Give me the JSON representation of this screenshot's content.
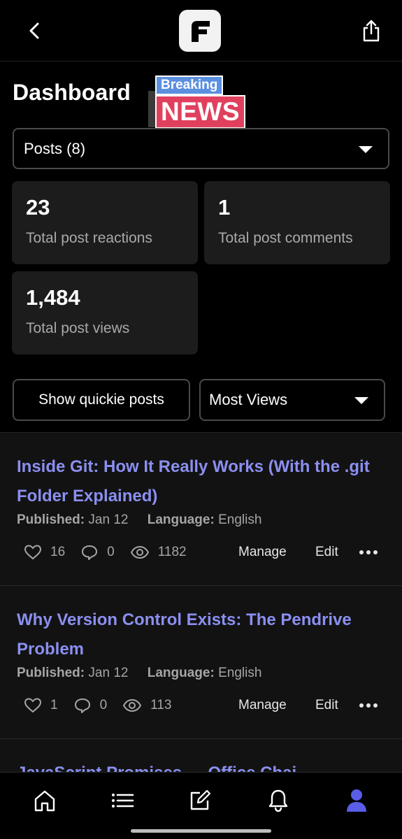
{
  "header": {
    "title": "Dashboard",
    "badge_top": "Breaking",
    "badge_bottom": "NEWS"
  },
  "posts_select": {
    "value": "Posts (8)"
  },
  "stats": [
    {
      "value": "23",
      "label": "Total post reactions"
    },
    {
      "value": "1",
      "label": "Total post comments"
    },
    {
      "value": "1,484",
      "label": "Total post views"
    }
  ],
  "filters": {
    "quickie_label": "Show quickie posts",
    "sort_value": "Most Views"
  },
  "posts": [
    {
      "title": "Inside Git: How It Really Works (With the .git Folder Explained)",
      "published_label": "Published:",
      "published": "Jan 12",
      "language_label": "Language:",
      "language": "English",
      "likes": "16",
      "comments": "0",
      "views": "1182",
      "manage": "Manage",
      "edit": "Edit"
    },
    {
      "title": "Why Version Control Exists: The Pendrive Problem",
      "published_label": "Published:",
      "published": "Jan 12",
      "language_label": "Language:",
      "language": "English",
      "likes": "1",
      "comments": "0",
      "views": "113",
      "manage": "Manage",
      "edit": "Edit"
    },
    {
      "title": "JavaScript Promises — Office Chai"
    }
  ],
  "icons": {
    "back": "back-arrow-icon",
    "logo": "app-logo",
    "share": "share-icon",
    "home": "home-icon",
    "list": "list-icon",
    "write": "edit-icon",
    "bell": "bell-icon",
    "profile": "user-icon"
  },
  "colors": {
    "accent": "#8b8ff0",
    "active_nav": "#5a5ee6",
    "badge_blue": "#5b8fe0",
    "badge_red": "#e0405e"
  }
}
